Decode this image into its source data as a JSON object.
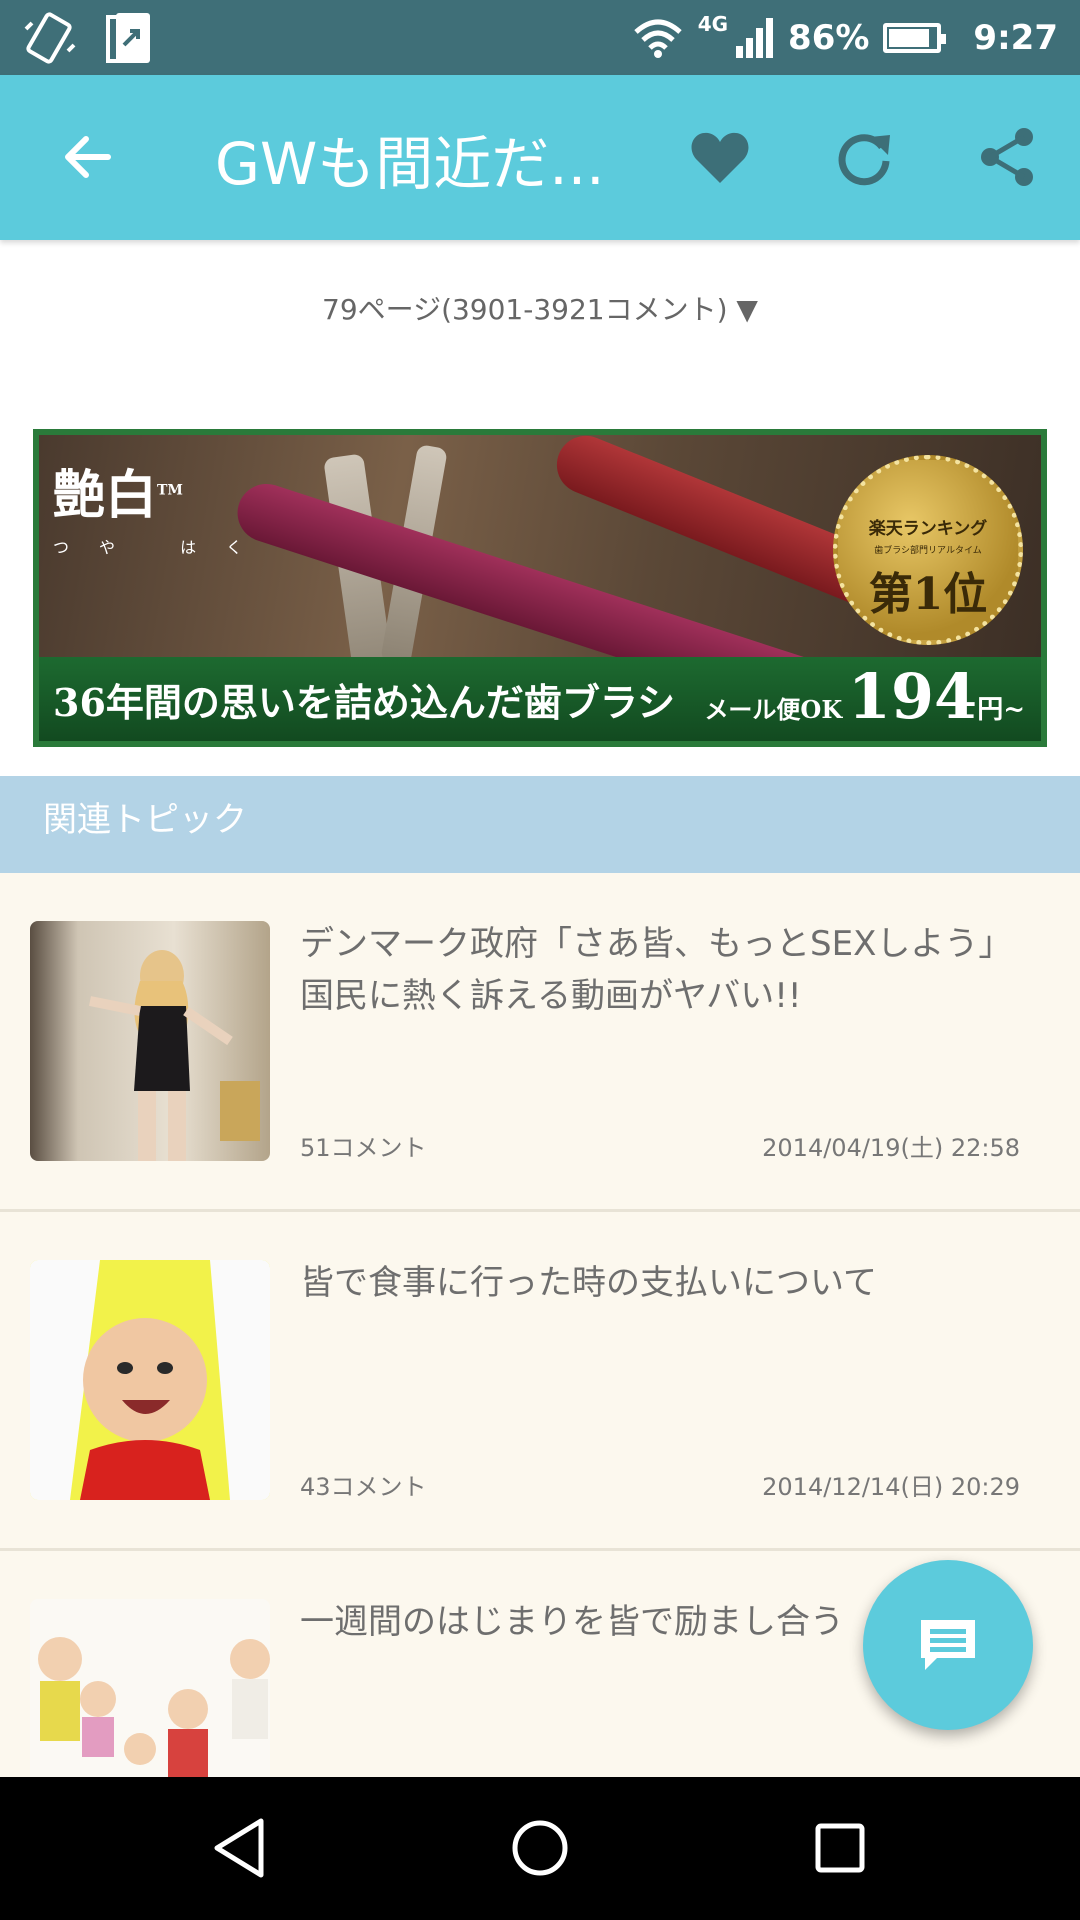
{
  "status_bar": {
    "network": "4G",
    "battery": "86%",
    "battery_level": 0.86,
    "time": "9:27",
    "icons": [
      "screen-rotate-icon",
      "screenshot-icon",
      "wifi-icon",
      "signal-icon",
      "battery-icon"
    ]
  },
  "appbar": {
    "title": "GWも間近だ...",
    "back_icon": "arrow-left-icon",
    "favorite_icon": "heart-icon",
    "refresh_icon": "refresh-icon",
    "share_icon": "share-icon"
  },
  "page_selector": {
    "label": "79ページ(3901-3921コメント) ▼"
  },
  "ad": {
    "brand": "艶白",
    "brand_mark": "TM",
    "brand_reading": "つや はく",
    "medal_line1": "楽天ランキング",
    "medal_line2": "歯ブラシ部門リアルタイム",
    "medal_rank": "第1位",
    "tagline": "36年間の思いを詰め込んだ歯ブラシ",
    "shipping": "メール便OK",
    "price": "194",
    "price_suffix": "円~"
  },
  "related": {
    "heading": "関連トピック",
    "items": [
      {
        "title": "デンマーク政府「さあ皆、もっとSEXしよう」　国民に熱く訴える動画がヤバい!!",
        "comments": "51コメント",
        "date": "2014/04/19(土) 22:58"
      },
      {
        "title": "皆で食事に行った時の支払いについて",
        "comments": "43コメント",
        "date": "2014/12/14(日) 20:29"
      },
      {
        "title": "一週間のはじまりを皆で励まし合う",
        "comments": "",
        "date": ""
      }
    ]
  },
  "fab": {
    "icon": "comment-icon"
  },
  "navbar": {
    "icons": [
      "back-triangle-icon",
      "home-circle-icon",
      "recents-square-icon"
    ]
  },
  "colors": {
    "statusbar": "#3f6f78",
    "appbar": "#5ccbdc",
    "related_header": "#b3d3e6",
    "list_bg": "#fcf8ee"
  }
}
